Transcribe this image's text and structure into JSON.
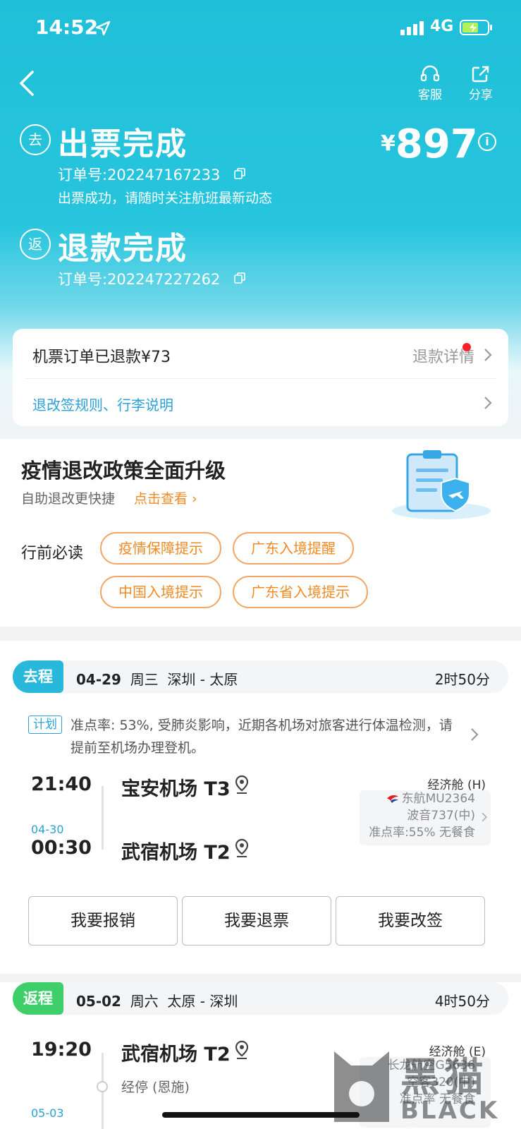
{
  "status_bar": {
    "time": "14:52",
    "network": "4G"
  },
  "header": {
    "service_label": "客服",
    "share_label": "分享"
  },
  "outbound": {
    "badge": "去",
    "title": "出票完成",
    "order_no": "订单号:202247167233",
    "message": "出票成功，请随时关注航班最新动态",
    "price_symbol": "¥",
    "price": "897"
  },
  "return_section": {
    "badge": "返",
    "title": "退款完成",
    "order_no": "订单号:202247227262"
  },
  "refund_card": {
    "refunded_text": "机票订单已退款¥73",
    "detail_label": "退款详情",
    "rules_link": "退改签规则、行李说明"
  },
  "policy": {
    "title": "疫情退改政策全面升级",
    "subtitle": "自助退改更快捷",
    "link": "点击查看 ›",
    "must_read_label": "行前必读",
    "tags": [
      "疫情保障提示",
      "广东入境提醒",
      "中国入境提示",
      "广东省入境提示"
    ]
  },
  "trip_out": {
    "badge": "去程",
    "date": "04-29",
    "weekday": "周三",
    "route": "深圳 - 太原",
    "duration": "2时50分",
    "plan_tag": "计划",
    "notice": "准点率: 53%, 受肺炎影响，近期各机场对旅客进行体温检测，请提前至机场办理登机。",
    "dep_time": "21:40",
    "dep_airport": "宝安机场 T3",
    "arr_date": "04-30",
    "arr_time": "00:30",
    "arr_airport": "武宿机场 T2",
    "cabin": "经济舱 (H)",
    "airline_flight": "东航MU2364",
    "aircraft": "波音737(中)",
    "punctuality": "准点率:55% 无餐食",
    "buttons": [
      "我要报销",
      "我要退票",
      "我要改签"
    ]
  },
  "trip_ret": {
    "badge": "返程",
    "date": "05-02",
    "weekday": "周六",
    "route": "太原 - 深圳",
    "duration": "4时50分",
    "dep_time": "19:20",
    "dep_airport": "武宿机场 T2",
    "cabin": "经济舱 (E)",
    "airline_flight": "长龙航空G5636",
    "aircraft": "空客320(中)",
    "punctuality": "准点率 无餐食",
    "via": "经停 (恩施)",
    "arr_date": "05-03"
  },
  "watermark": {
    "text_cn": "黑猫",
    "text_en": "BLACK CAT"
  },
  "colors": {
    "primary": "#20bfd9",
    "orange": "#f08a24",
    "link": "#2ca0d8",
    "outbound_badge": "#28b8dc",
    "return_badge": "#3fcf6a"
  }
}
